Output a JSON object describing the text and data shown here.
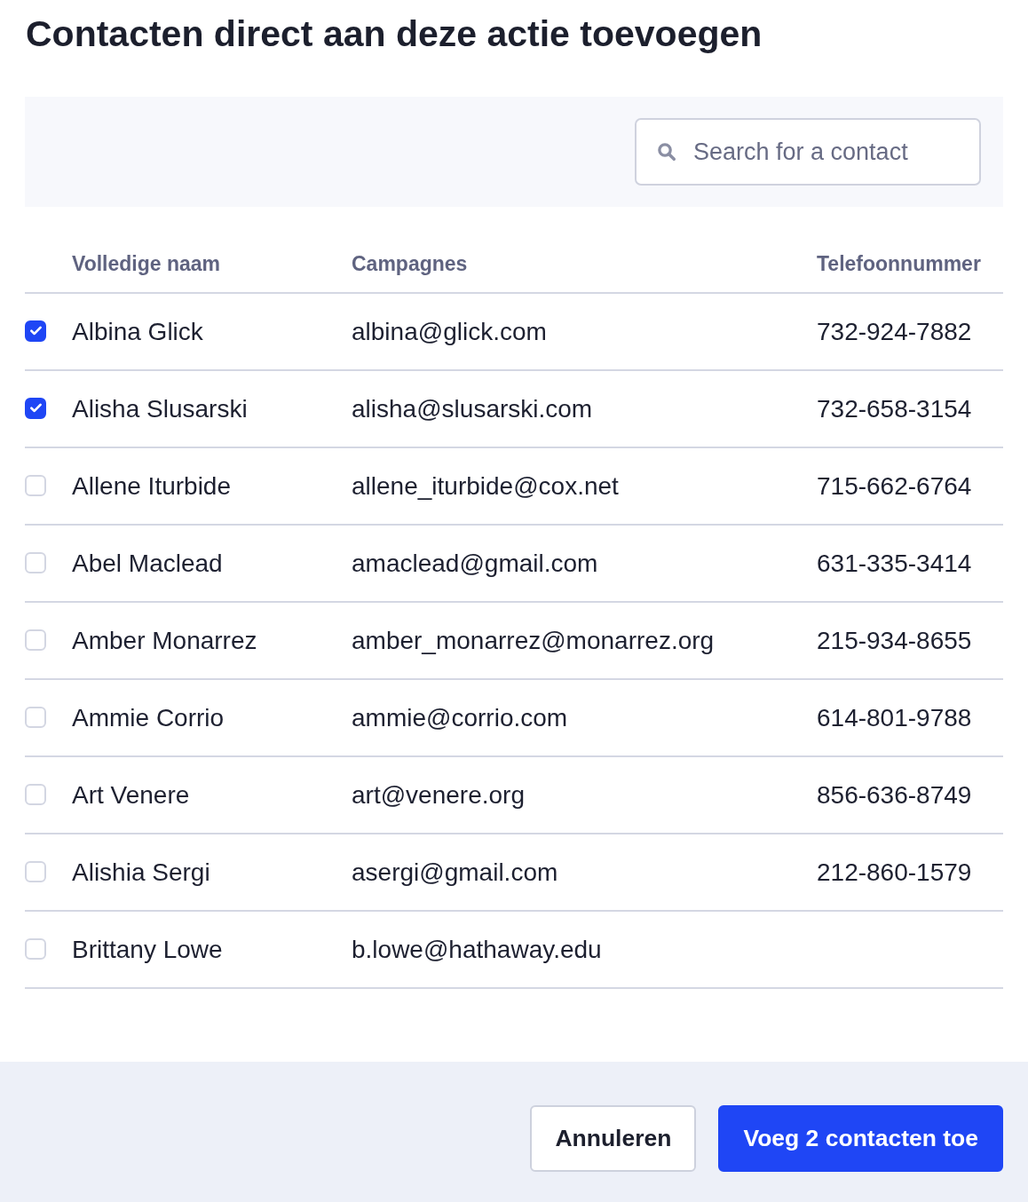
{
  "title": "Contacten direct aan deze actie toevoegen",
  "search": {
    "placeholder": "Search for a contact"
  },
  "table": {
    "columns": [
      "Volledige naam",
      "Campagnes",
      "Telefoonnummer"
    ],
    "rows": [
      {
        "checked": true,
        "name": "Albina Glick",
        "campaign": "albina@glick.com",
        "phone": "732-924-7882"
      },
      {
        "checked": true,
        "name": "Alisha Slusarski",
        "campaign": "alisha@slusarski.com",
        "phone": "732-658-3154"
      },
      {
        "checked": false,
        "name": "Allene Iturbide",
        "campaign": "allene_iturbide@cox.net",
        "phone": "715-662-6764"
      },
      {
        "checked": false,
        "name": "Abel Maclead",
        "campaign": "amaclead@gmail.com",
        "phone": "631-335-3414"
      },
      {
        "checked": false,
        "name": "Amber Monarrez",
        "campaign": "amber_monarrez@monarrez.org",
        "phone": "215-934-8655"
      },
      {
        "checked": false,
        "name": "Ammie Corrio",
        "campaign": "ammie@corrio.com",
        "phone": "614-801-9788"
      },
      {
        "checked": false,
        "name": "Art Venere",
        "campaign": "art@venere.org",
        "phone": "856-636-8749"
      },
      {
        "checked": false,
        "name": "Alishia Sergi",
        "campaign": "asergi@gmail.com",
        "phone": "212-860-1579"
      },
      {
        "checked": false,
        "name": "Brittany Lowe",
        "campaign": "b.lowe@hathaway.edu"
      }
    ]
  },
  "buttons": [
    {
      "label": "Annuleren",
      "kind": "secondary"
    },
    {
      "label": "Voeg 2 contacten toe",
      "kind": "primary"
    }
  ]
}
